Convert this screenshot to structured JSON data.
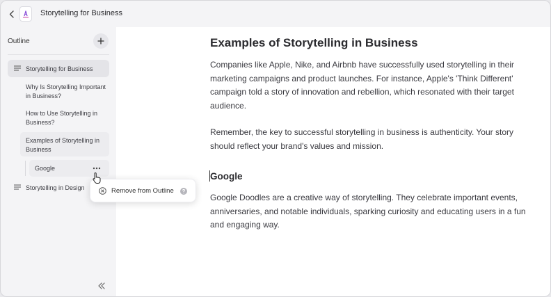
{
  "app": {
    "title": "Storytelling for Business",
    "icon": "document-app-icon"
  },
  "sidebar": {
    "heading": "Outline",
    "items": [
      {
        "label": "Storytelling for Business",
        "level": 1,
        "active": true
      },
      {
        "label": "Why Is Storytelling Important in Business?",
        "level": 2
      },
      {
        "label": "How to Use Storytelling in Business?",
        "level": 2
      },
      {
        "label": "Examples of Storytelling in Business",
        "level": 2
      },
      {
        "label": "Google",
        "level": 3
      },
      {
        "label": "Storytelling in Design",
        "level": 1
      }
    ]
  },
  "context_menu": {
    "remove_label": "Remove from Outline"
  },
  "document": {
    "heading": "Examples of Storytelling in Business",
    "paragraph1": "Companies like Apple, Nike, and Airbnb have successfully used storytelling in their marketing campaigns and product launches. For instance, Apple's 'Think Different' campaign told a story of innovation and rebellion, which resonated with their target audience.",
    "paragraph2": "Remember, the key to successful storytelling in business is authenticity. Your story should reflect your brand's values and mission.",
    "subheading": "Google",
    "paragraph3": "Google Doodles are a creative way of storytelling. They celebrate important events, anniversaries, and notable individuals, sparking curiosity and educating users in a fun and engaging way."
  }
}
